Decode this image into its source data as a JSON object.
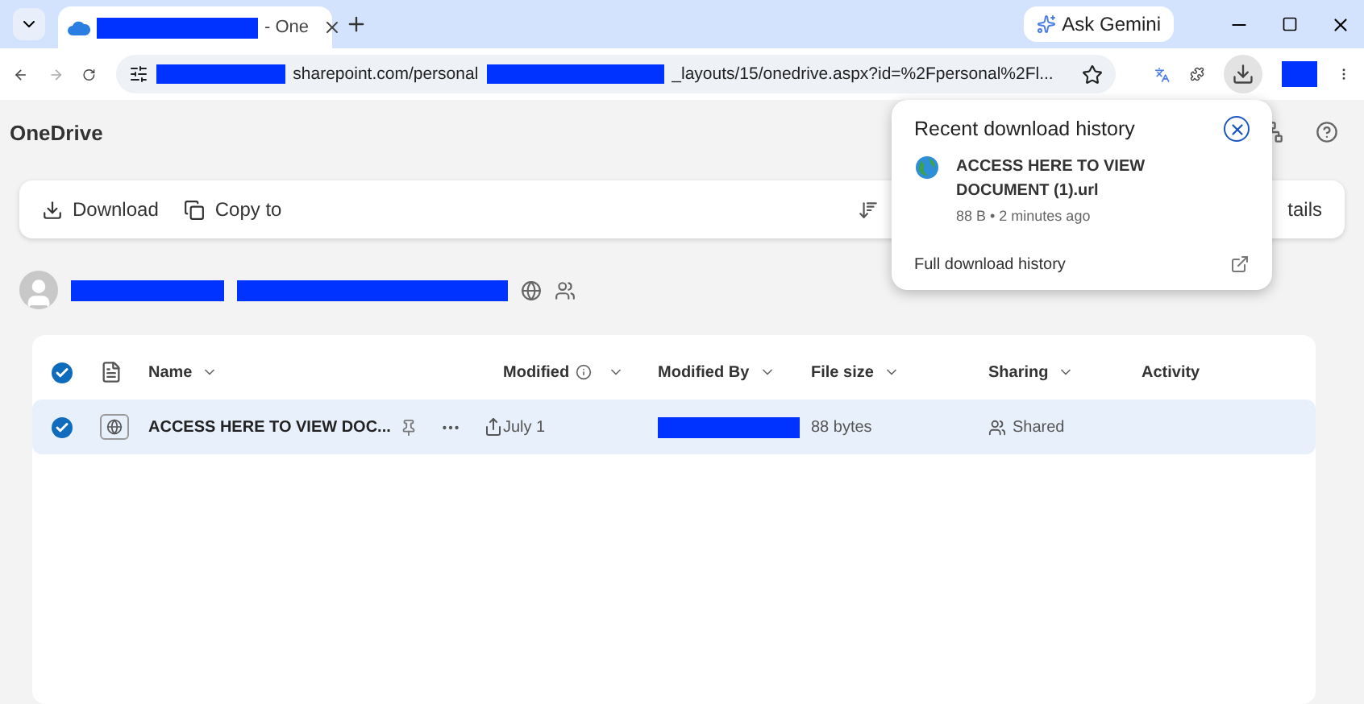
{
  "browser": {
    "tab": {
      "title": "- One",
      "selected": true
    },
    "ask_button": "Ask Gemini",
    "url_host": "sharepoint.com/personal",
    "url_path": "_layouts/15/onedrive.aspx?id=%2Fpersonal%2Fl..."
  },
  "app": {
    "title": "OneDrive"
  },
  "toolbar": {
    "actions": [
      {
        "label": "Download",
        "kind": "download"
      },
      {
        "label": "Copy to",
        "kind": "copy"
      }
    ],
    "right_label": "tails"
  },
  "table": {
    "columns": [
      {
        "label": "Name",
        "info": false,
        "sortable": true
      },
      {
        "label": "Modified",
        "info": true,
        "sortable": true
      },
      {
        "label": "Modified By",
        "info": false,
        "sortable": true
      },
      {
        "label": "File size",
        "info": false,
        "sortable": true
      },
      {
        "label": "Sharing",
        "info": false,
        "sortable": true
      },
      {
        "label": "Activity",
        "info": false,
        "sortable": false
      }
    ],
    "all_checked": true,
    "rows": [
      {
        "name": "ACCESS HERE TO VIEW DOC...",
        "modified": "July 1",
        "file_size": "88 bytes",
        "sharing": "Shared",
        "selected": true
      }
    ]
  },
  "download_popup": {
    "title": "Recent download history",
    "file_name": "ACCESS HERE TO VIEW DOCUMENT (1).url",
    "meta": "88 B • 2 minutes ago",
    "footer_link": "Full download history"
  }
}
